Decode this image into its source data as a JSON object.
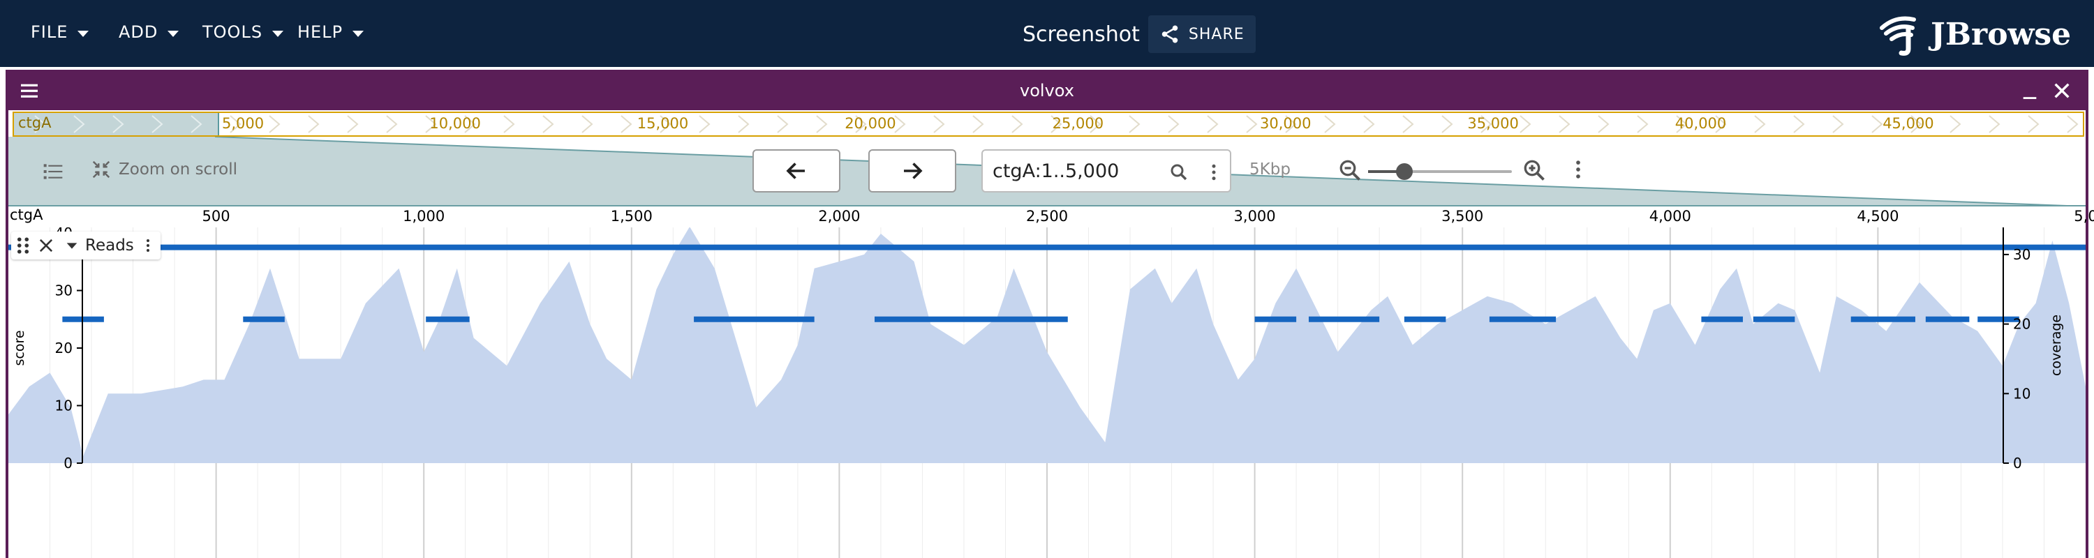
{
  "menu": [
    {
      "label": "FILE"
    },
    {
      "label": "ADD"
    },
    {
      "label": "TOOLS"
    },
    {
      "label": "HELP"
    }
  ],
  "header": {
    "session_title": "Screenshot",
    "share_label": "SHARE",
    "logo_text": "JBrowse"
  },
  "view": {
    "title": "volvox",
    "overview": {
      "contig": "ctgA",
      "ticks": [
        "5,000",
        "10,000",
        "15,000",
        "20,000",
        "25,000",
        "30,000",
        "35,000",
        "40,000",
        "45,000"
      ]
    },
    "toolbar": {
      "zoom_on_scroll": "Zoom on scroll",
      "location": "ctgA:1..5,000",
      "bp_per_view": "5Kbp",
      "zoom_level": 0.25
    },
    "ruler": {
      "contig": "ctgA",
      "labels": [
        "500",
        "1,000",
        "1,500",
        "2,000",
        "2,500",
        "3,000",
        "3,500",
        "4,000",
        "4,500",
        "5,0"
      ]
    },
    "track": {
      "name": "Reads",
      "left_axis_label": "score",
      "right_axis_label": "coverage"
    }
  },
  "colors": {
    "appbar": "#0d233f",
    "view_header": "#5a1e57",
    "coverage_fill": "#c6d5ee",
    "feature": "#1565c0",
    "overview_border": "#d6a000"
  },
  "chart_data": {
    "type": "area",
    "x_unit": "bp",
    "x": [
      0,
      50,
      100,
      150,
      180,
      240,
      280,
      320,
      420,
      470,
      520,
      580,
      630,
      700,
      800,
      860,
      940,
      1000,
      1040,
      1080,
      1120,
      1200,
      1280,
      1350,
      1400,
      1440,
      1500,
      1560,
      1600,
      1640,
      1700,
      1750,
      1800,
      1860,
      1900,
      1940,
      2000,
      2060,
      2100,
      2180,
      2220,
      2300,
      2380,
      2420,
      2500,
      2580,
      2640,
      2700,
      2760,
      2800,
      2860,
      2900,
      2960,
      3000,
      3050,
      3100,
      3150,
      3200,
      3280,
      3320,
      3380,
      3440,
      3500,
      3560,
      3620,
      3700,
      3760,
      3820,
      3880,
      3920,
      3960,
      4000,
      4060,
      4120,
      4160,
      4200,
      4260,
      4300,
      4360,
      4400,
      4460,
      4520,
      4600,
      4680,
      4740,
      4800,
      4840,
      4880,
      4920,
      4960,
      5000
    ],
    "series": [
      {
        "axis": "right",
        "values": [
          7,
          11,
          13,
          8,
          1,
          10,
          10,
          10,
          11,
          12,
          12,
          20,
          28,
          15,
          15,
          23,
          28,
          16,
          21,
          28,
          18,
          14,
          23,
          29,
          20,
          15,
          12,
          25,
          30,
          34,
          28,
          18,
          8,
          12,
          17,
          28,
          29,
          30,
          33,
          29,
          20,
          17,
          21,
          28,
          16,
          8,
          3,
          25,
          28,
          23,
          28,
          20,
          12,
          15,
          23,
          28,
          22,
          16,
          22,
          24,
          17,
          20,
          22,
          24,
          23,
          20,
          22,
          24,
          18,
          15,
          22,
          23,
          17,
          25,
          28,
          20,
          23,
          22,
          13,
          24,
          22,
          19,
          26,
          21,
          19,
          14,
          20,
          23,
          32,
          23,
          11
        ]
      }
    ],
    "features": [
      {
        "start": 130,
        "end": 230,
        "score": 25
      },
      {
        "start": 565,
        "end": 665,
        "score": 25
      },
      {
        "start": 1005,
        "end": 1110,
        "score": 25
      },
      {
        "start": 1650,
        "end": 1940,
        "score": 25
      },
      {
        "start": 2085,
        "end": 2550,
        "score": 25
      },
      {
        "start": 3000,
        "end": 3100,
        "score": 25
      },
      {
        "start": 3130,
        "end": 3300,
        "score": 25
      },
      {
        "start": 3360,
        "end": 3460,
        "score": 25
      },
      {
        "start": 3565,
        "end": 3725,
        "score": 25
      },
      {
        "start": 4075,
        "end": 4175,
        "score": 25
      },
      {
        "start": 4200,
        "end": 4300,
        "score": 25
      },
      {
        "start": 4435,
        "end": 4590,
        "score": 25
      },
      {
        "start": 4615,
        "end": 4720,
        "score": 25
      },
      {
        "start": 4740,
        "end": 4840,
        "score": 25
      },
      {
        "start": 0,
        "end": 5000,
        "score": 37.5
      }
    ],
    "xlim": [
      0,
      5000
    ],
    "left_axis": {
      "label": "score",
      "ylim": [
        0,
        40
      ],
      "ticks": [
        0,
        10,
        20,
        30,
        40
      ]
    },
    "right_axis": {
      "label": "coverage",
      "ylim": [
        0,
        34
      ],
      "ticks": [
        0,
        10,
        20,
        30
      ]
    }
  }
}
